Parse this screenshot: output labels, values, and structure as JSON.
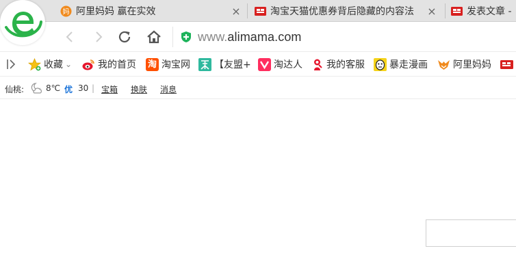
{
  "browser": {
    "tabs": [
      {
        "title": "阿里妈妈 赢在实效",
        "favicon": "alimama-icon",
        "close": "×"
      },
      {
        "title": "淘宝天猫优惠券背后隐藏的内容法",
        "favicon": "newspaper-icon",
        "close": "×"
      },
      {
        "title": "发表文章 -",
        "favicon": "newspaper-icon"
      }
    ],
    "address": {
      "url_prefix": "www.",
      "url_domain": "alimama.com"
    }
  },
  "bookmarks": {
    "toggle_icon": "sidebar-toggle-icon",
    "items": [
      {
        "label": "收藏",
        "icon": "star-icon",
        "caret": "⌄"
      },
      {
        "label": "我的首页",
        "icon": "weibo-icon"
      },
      {
        "label": "淘宝网",
        "icon": "taobao-icon",
        "icon_glyph": "淘"
      },
      {
        "label": "【友盟+",
        "icon": "umeng-icon"
      },
      {
        "label": "淘达人",
        "icon": "taodaren-icon"
      },
      {
        "label": "我的客服",
        "icon": "customer-service-icon"
      },
      {
        "label": "暴走漫画",
        "icon": "baozou-icon"
      },
      {
        "label": "阿里妈妈",
        "icon": "alimama-fox-icon"
      }
    ]
  },
  "status": {
    "city": "仙桃:",
    "weather_icon": "cloudy-moon-icon",
    "temperature": "8℃",
    "aqi_label": "优",
    "aqi_value": "30",
    "separator": "|",
    "links": [
      "宝箱",
      "换肤",
      "消息"
    ]
  },
  "colors": {
    "logo_green": "#2bb34a",
    "shield_green": "#1db35b",
    "aqi_blue": "#1a73d9",
    "alimama_orange": "#f08a1d",
    "weibo_red": "#e6162d"
  }
}
